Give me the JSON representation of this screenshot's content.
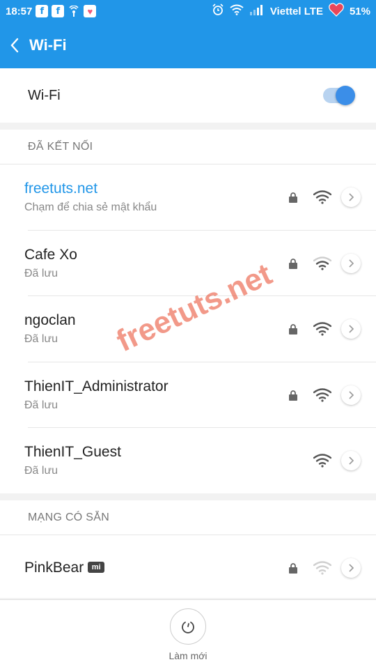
{
  "status_bar": {
    "time": "18:57",
    "carrier": "Viettel LTE",
    "battery": "51%"
  },
  "app_bar": {
    "title": "Wi-Fi"
  },
  "wifi_toggle": {
    "label": "Wi-Fi",
    "enabled": true
  },
  "connected_section": {
    "header": "ĐÃ KẾT NỐI",
    "networks": [
      {
        "name": "freetuts.net",
        "subtitle": "Chạm để chia sẻ mật khẩu",
        "locked": true,
        "signal": "full",
        "active": true
      },
      {
        "name": "Cafe Xo",
        "subtitle": "Đã lưu",
        "locked": true,
        "signal": "weak",
        "active": false
      },
      {
        "name": "ngoclan",
        "subtitle": "Đã lưu",
        "locked": true,
        "signal": "full",
        "active": false
      },
      {
        "name": "ThienIT_Administrator",
        "subtitle": "Đã lưu",
        "locked": true,
        "signal": "full",
        "active": false
      },
      {
        "name": "ThienIT_Guest",
        "subtitle": "Đã lưu",
        "locked": false,
        "signal": "full",
        "active": false
      }
    ]
  },
  "available_section": {
    "header": "MẠNG CÓ SẴN",
    "networks": [
      {
        "name": "PinkBear",
        "badge": "mi",
        "locked": true,
        "signal": "faint"
      }
    ]
  },
  "bottom": {
    "refresh_label": "Làm mới"
  },
  "watermark": "freetuts.net",
  "colors": {
    "primary": "#2196e8",
    "toggle_on": "#3b8ee8",
    "watermark": "#e84628"
  }
}
